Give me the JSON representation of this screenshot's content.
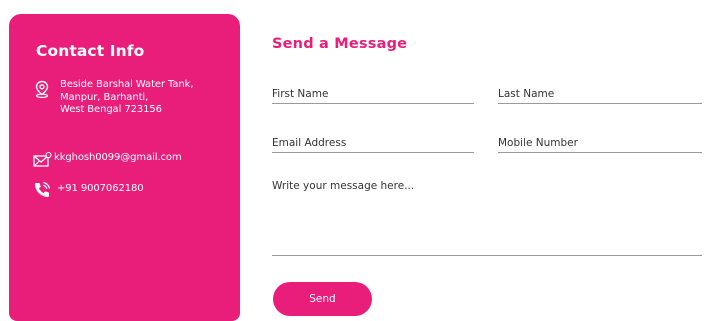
{
  "contact_info": {
    "title": "Contact Info",
    "address": "Beside Barshal Water Tank,\nManpur, Barhanti,\nWest Bengal 723156",
    "email": "kkghosh0099@gmail.com",
    "phone": "+91 9007062180",
    "icons": {
      "address": "location-pin-icon",
      "email": "envelope-icon",
      "phone": "phone-icon"
    }
  },
  "form": {
    "title": "Send a Message",
    "first_name_placeholder": "First Name",
    "last_name_placeholder": "Last Name",
    "email_placeholder": "Email Address",
    "mobile_placeholder": "Mobile Number",
    "message_placeholder": "Write your message here...",
    "send_label": "Send"
  },
  "colors": {
    "accent": "#e91e7a",
    "underline": "#9a9a9a",
    "text": "#333333"
  }
}
